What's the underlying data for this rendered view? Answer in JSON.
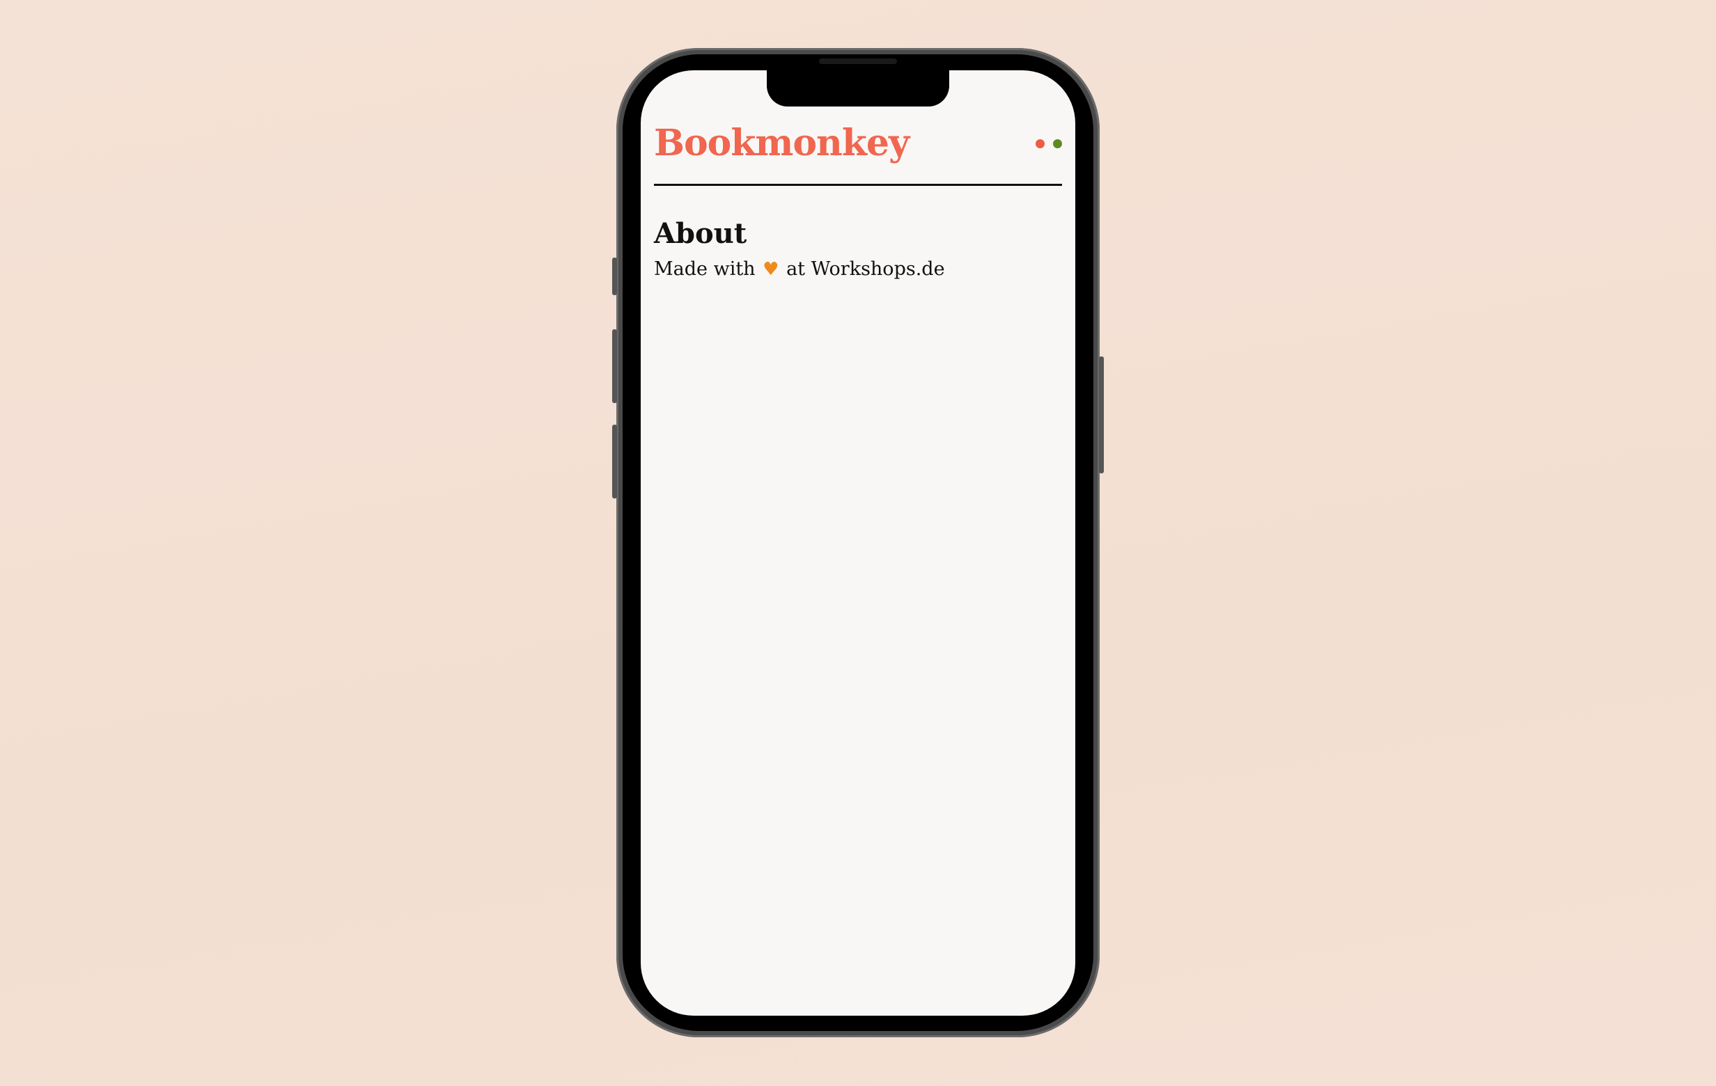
{
  "app": {
    "title": "Bookmonkey"
  },
  "status": {
    "indicators": [
      "red-dot",
      "green-dot"
    ]
  },
  "page": {
    "heading": "About",
    "text_before": "Made with",
    "heart_icon": "♥",
    "text_after": "at",
    "link_label": "Workshops.de"
  },
  "colors": {
    "accent": "#f0664f",
    "background": "#f4e0d4",
    "screen": "#f8f7f5",
    "heart": "#f08a1c",
    "status_red": "#ef5b45",
    "status_green": "#5e8a22"
  }
}
